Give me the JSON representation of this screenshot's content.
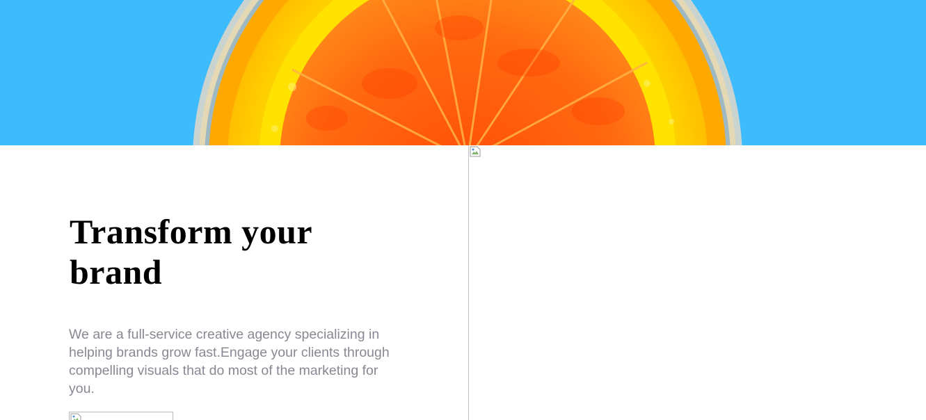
{
  "hero": {
    "image": "orange-juice-glass-top-view",
    "background_color": "#3dbbfd",
    "fruit_colors": [
      "#ff5a0a",
      "#ff8c00",
      "#ffd500"
    ]
  },
  "main": {
    "headline": "Transform your brand",
    "description": "We are a full-service creative agency specializing in helping brands grow fast.Engage your clients through compelling visuals that do most of the marketing for you.",
    "cta_image": "broken-image-icon",
    "side_image": "broken-image-icon"
  }
}
